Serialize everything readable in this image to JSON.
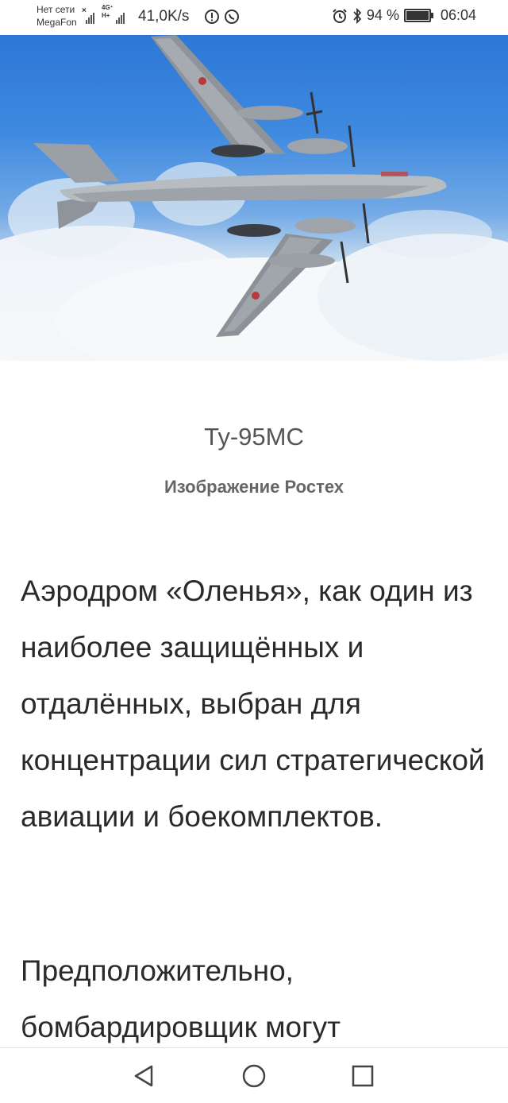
{
  "status_bar": {
    "carrier_line1": "Нет сети",
    "carrier_line2": "MegaFon",
    "network_badge_top": "4G⁺",
    "network_badge_bottom": "H+",
    "speed": "41,0K/s",
    "battery_text": "94 %",
    "battery_level": 0.94,
    "time": "06:04",
    "icons": [
      "signal-icon",
      "alert-icon",
      "whatsapp-icon",
      "alarm-icon",
      "bluetooth-icon",
      "battery-icon"
    ]
  },
  "figure": {
    "title": "Ту-95МС",
    "credit": "Изображение Ростех"
  },
  "article": {
    "paragraphs": [
      "Аэродром «Оленья», как один из наиболее защищённых и отдалённых, выбран для концентрации сил стратегической авиации и боекомплектов.",
      "Предположительно, бомбардировщик могут"
    ]
  },
  "nav_bar": {
    "icons": [
      "back-icon",
      "home-icon",
      "recents-icon"
    ]
  }
}
